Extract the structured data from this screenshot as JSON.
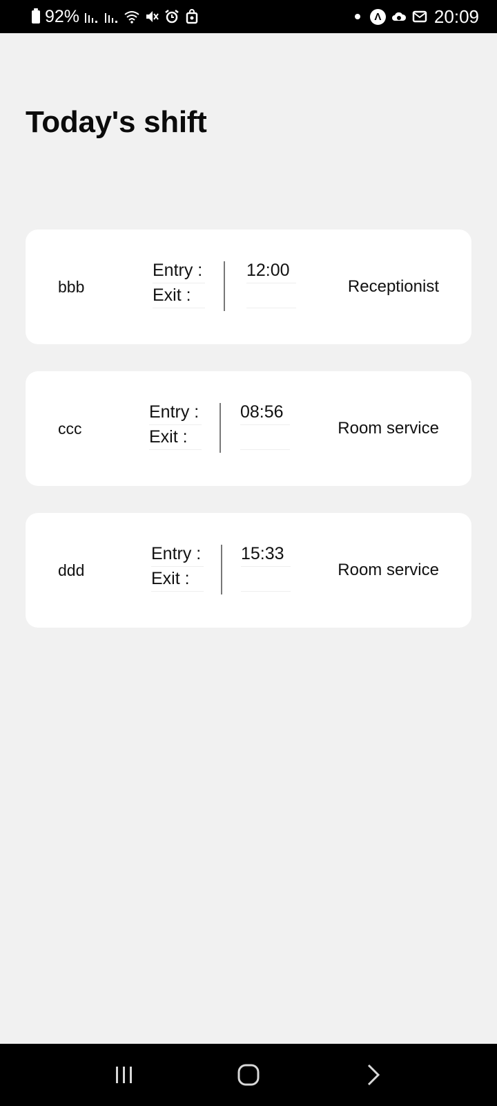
{
  "status_bar": {
    "battery_percent": "92%",
    "time": "20:09",
    "left_icons": [
      "battery-icon",
      "signal-icon",
      "signal-icon",
      "wifi-icon",
      "mute-icon",
      "alarm-icon",
      "bag-icon"
    ],
    "right_icons": [
      "notification-dot-icon",
      "app-a-icon",
      "cloud-icon",
      "mail-icon"
    ],
    "app_icon_letter": "Λ"
  },
  "page": {
    "title": "Today's shift"
  },
  "shifts": [
    {
      "name": "bbb",
      "entry_label": "Entry :",
      "exit_label": "Exit :",
      "entry_time": "12:00",
      "exit_time": "",
      "role": "Receptionist"
    },
    {
      "name": "ccc",
      "entry_label": "Entry :",
      "exit_label": "Exit :",
      "entry_time": "08:56",
      "exit_time": "",
      "role": "Room service"
    },
    {
      "name": "ddd",
      "entry_label": "Entry :",
      "exit_label": "Exit :",
      "entry_time": "15:33",
      "exit_time": "",
      "role": "Room service"
    }
  ],
  "nav_bar": {
    "buttons": [
      "recent-apps-icon",
      "home-icon",
      "back-icon"
    ]
  },
  "colors": {
    "background": "#f1f1f1",
    "card": "#ffffff",
    "bars": "#000000",
    "divider": "#777777"
  }
}
